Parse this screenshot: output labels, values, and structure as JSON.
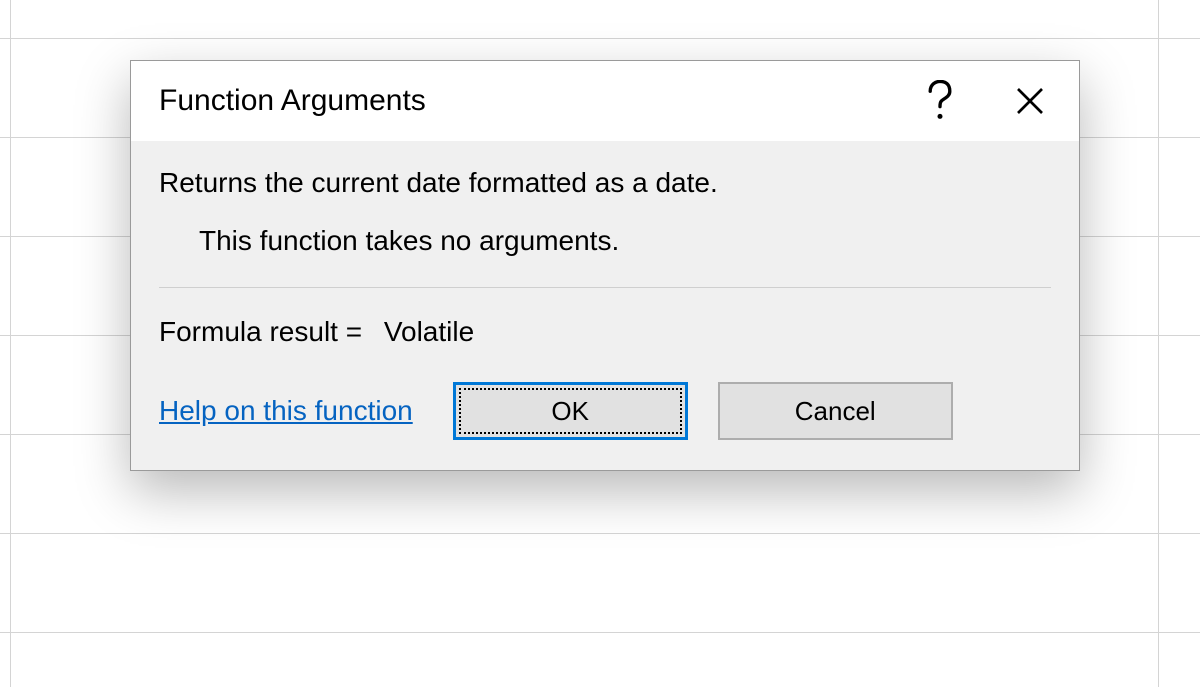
{
  "dialog": {
    "title": "Function Arguments",
    "description": "Returns the current date formatted as a date.",
    "no_arguments_text": "This function takes no arguments.",
    "result_label": "Formula result =",
    "result_value": "Volatile",
    "help_link": "Help on this function",
    "ok_label": "OK",
    "cancel_label": "Cancel"
  }
}
